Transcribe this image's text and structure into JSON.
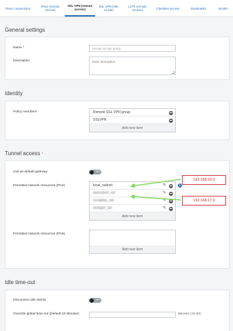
{
  "tabs": [
    {
      "label": "IPsec connections"
    },
    {
      "label": "IPsec (remote access)"
    },
    {
      "label": "SSL VPN (remote access)"
    },
    {
      "label": "SSL VPN (site-to-site)"
    },
    {
      "label": "L2TP (remote access)"
    },
    {
      "label": "Clientless access"
    },
    {
      "label": "Bookmarks"
    },
    {
      "label": "Bookm"
    }
  ],
  "active_tab": "SSL VPN (remote access)",
  "general": {
    "title": "General settings",
    "name_label": "Name *",
    "name_placeholder": "remote ssl vpn policy",
    "description_label": "Description",
    "description_placeholder": "Enter description"
  },
  "identity": {
    "title": "Identity",
    "policy_members_label": "Policy members",
    "members": [
      "Remote SSL VPN group",
      "SSLVPN"
    ],
    "add_new": "Add new item"
  },
  "tunnel": {
    "title": "Tunnel access",
    "required_marker": "*",
    "default_gateway_label": "Use as default gateway",
    "default_gateway_state": "OFF",
    "ipv4_label": "Permitted network resources (IPv4)",
    "ipv4_items": [
      "local_subnet",
      "oberstdorf_nel",
      "nordpfalz_net",
      "stuttgart_lan"
    ],
    "ipv4_add_new": "Add new item",
    "ipv6_label": "Permitted network resources (IPv6)",
    "ipv6_add_new": "Add new item"
  },
  "annotations": {
    "callout_1": "192.168.16.0",
    "callout_2": "192.168.17.0",
    "accent_color": "#d23a3a",
    "arrow_color": "#7ed957"
  },
  "idle": {
    "title": "Idle time-out",
    "disconnect_label": "Disconnect idle clients",
    "disconnect_state": "OFF",
    "override_label": "Override global time-out (Default 15 Minutes)",
    "override_value": "",
    "minutes_hint": "Minutes (15-60)"
  }
}
